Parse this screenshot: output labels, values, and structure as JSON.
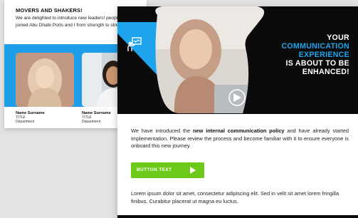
{
  "back_card": {
    "title": "MOVERS AND SHAKERS!",
    "body": "We are delighted to introduce new leaders! people have joined Abu Dhabi Ports and t from strength to strength",
    "people": [
      {
        "name": "Name Surname",
        "title": "TITLE",
        "department": "Department"
      },
      {
        "name": "Name Surname",
        "title": "TITLE",
        "department": "Department"
      }
    ]
  },
  "front_card": {
    "headline": {
      "line1": "YOUR",
      "line2": "COMMUNICATION",
      "line3": "EXPERIENCE",
      "line4": "IS ABOUT TO BE",
      "line5": "ENHANCED!"
    },
    "intro_before": "We have introduced the ",
    "intro_bold": "new internal communication policy",
    "intro_after": " and have already started implementation. Please review the process and become familiar with it to ensure everyone is onboard this new journey.",
    "button_label": "BUTTON TEXT",
    "lorem": "Lorem ipsum dolor sit amet, consectetur adipiscing elit. Sed in velit sit amet lorem fringilla finibus. Curabitur placerat ut magna eu luctus."
  },
  "colors": {
    "accent_blue": "#1ea4ec",
    "button_green": "#6cc918",
    "hero_black": "#0b0b0b"
  },
  "icons": [
    "presentation-icon",
    "play-icon",
    "arrow-right-icon"
  ]
}
